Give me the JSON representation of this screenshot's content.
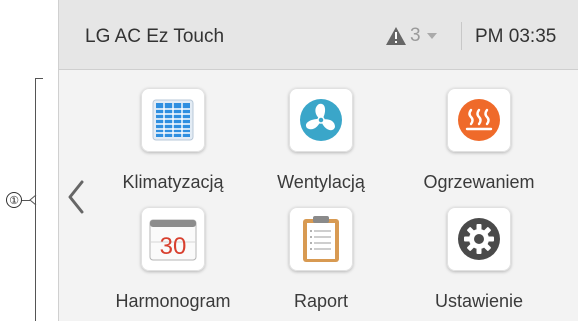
{
  "callout": {
    "number": "①"
  },
  "header": {
    "title": "LG AC Ez Touch",
    "alarm_count": "3",
    "time": "PM 03:35"
  },
  "menu": {
    "items": [
      {
        "label": "Klimatyzacją",
        "icon": "cassette-ac-icon"
      },
      {
        "label": "Wentylacją",
        "icon": "fan-icon"
      },
      {
        "label": "Ogrzewaniem",
        "icon": "heating-icon"
      },
      {
        "label": "Harmonogram",
        "icon": "calendar-icon",
        "day": "30"
      },
      {
        "label": "Raport",
        "icon": "clipboard-icon"
      },
      {
        "label": "Ustawienie",
        "icon": "gear-icon"
      }
    ]
  },
  "colors": {
    "accent_blue": "#2f8fe0",
    "fan_teal": "#3aa6c9",
    "heating_orange": "#ef6a2a",
    "calendar_red": "#d8402f",
    "gear_dark": "#4a4a4a"
  }
}
